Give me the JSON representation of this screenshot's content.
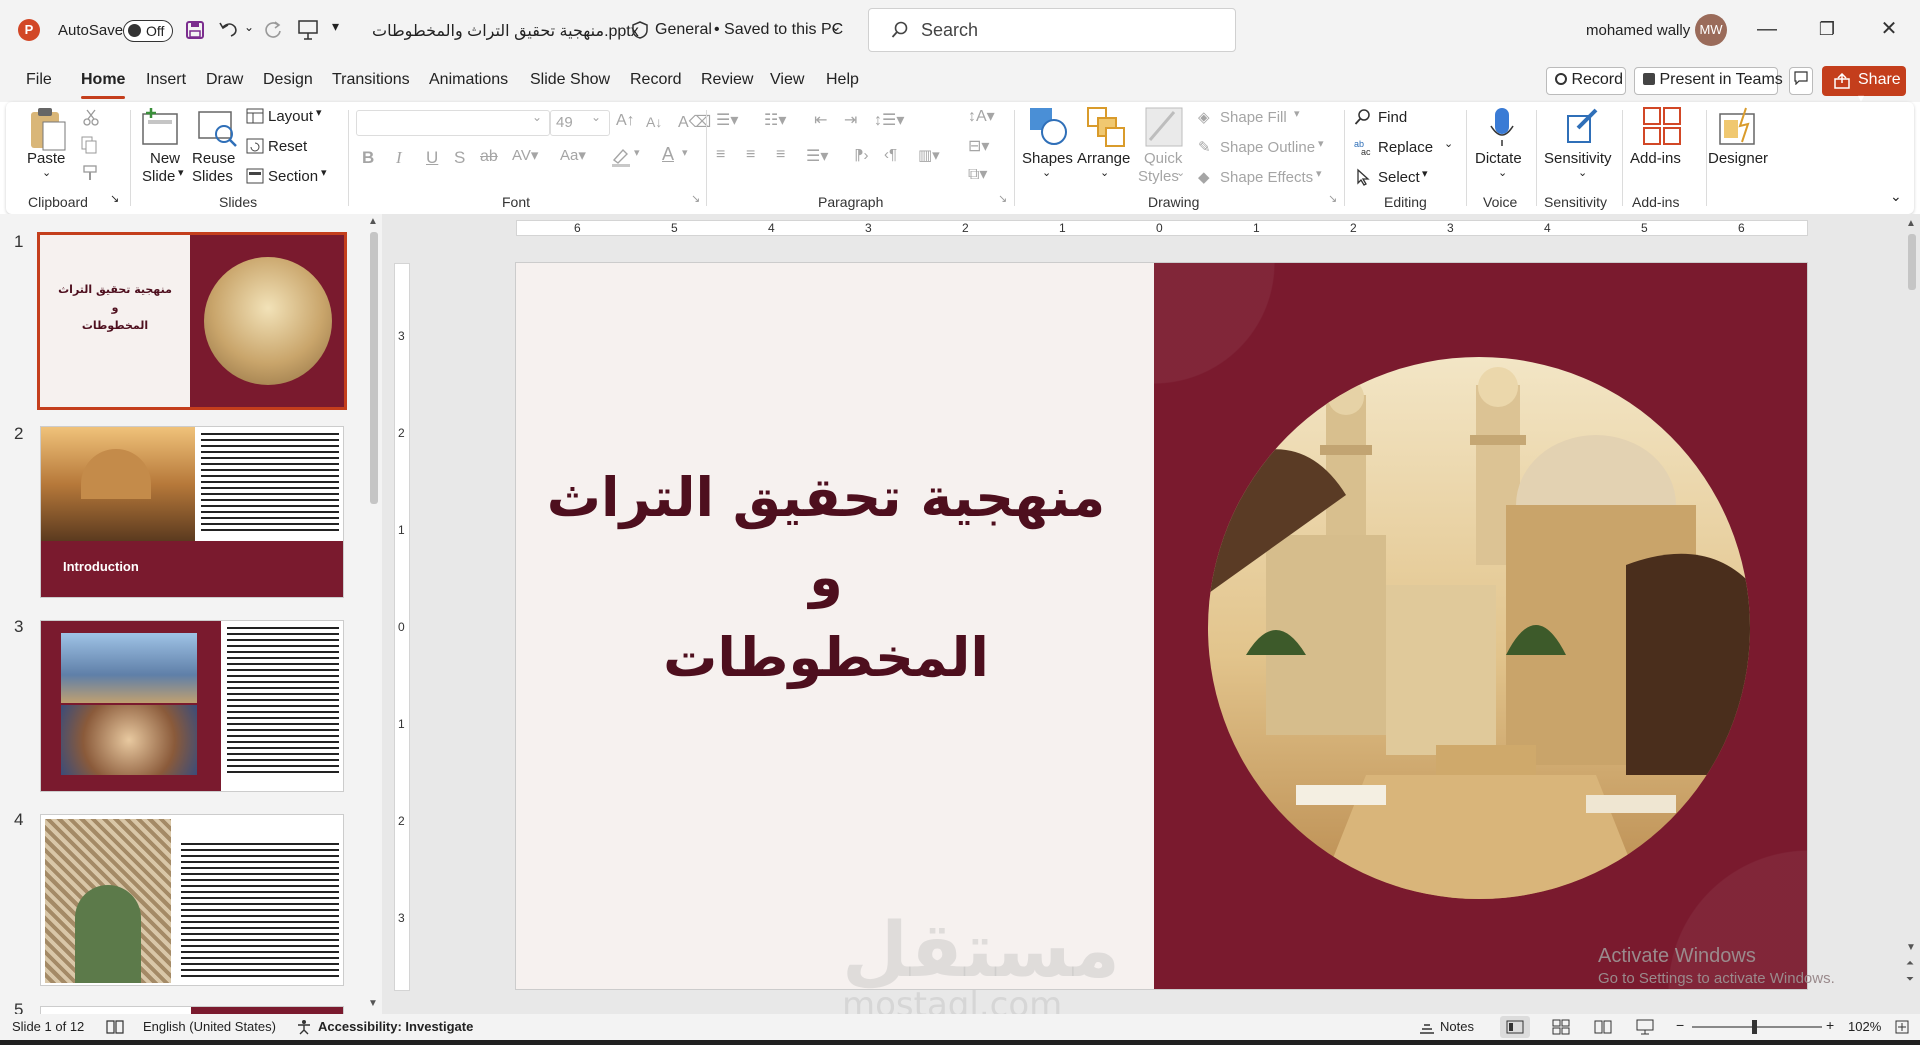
{
  "app": {
    "autosave_label": "AutoSave",
    "autosave_state": "Off",
    "file_title": "منهجية تحقيق التراث والمخطوطات.pptx",
    "sensitivity_label": "General",
    "save_status": "• Saved to this PC",
    "search_placeholder": "Search",
    "user_name": "mohamed wally",
    "user_initials": "MW"
  },
  "menu": {
    "tabs": [
      "File",
      "Home",
      "Insert",
      "Draw",
      "Design",
      "Transitions",
      "Animations",
      "Slide Show",
      "Record",
      "Review",
      "View",
      "Help"
    ],
    "active_tab": "Home",
    "record_button": "Record",
    "present_teams_button": "Present in Teams",
    "share_button": "Share"
  },
  "ribbon": {
    "clipboard": {
      "paste": "Paste",
      "group": "Clipboard"
    },
    "slides": {
      "new_slide_1": "New",
      "new_slide_2": "Slide",
      "reuse_1": "Reuse",
      "reuse_2": "Slides",
      "layout": "Layout",
      "reset": "Reset",
      "section": "Section",
      "group": "Slides"
    },
    "font": {
      "size_value": "49",
      "bold": "B",
      "italic": "I",
      "underline": "U",
      "shadow": "S",
      "strike": "ab",
      "group": "Font"
    },
    "paragraph": {
      "group": "Paragraph"
    },
    "drawing": {
      "shapes": "Shapes",
      "arrange": "Arrange",
      "quick_1": "Quick",
      "quick_2": "Styles",
      "shape_fill": "Shape Fill",
      "shape_outline": "Shape Outline",
      "shape_effects": "Shape Effects",
      "group": "Drawing"
    },
    "editing": {
      "find": "Find",
      "replace": "Replace",
      "select": "Select",
      "group": "Editing"
    },
    "voice": {
      "dictate": "Dictate",
      "group": "Voice"
    },
    "sensitivity": {
      "label": "Sensitivity",
      "group": "Sensitivity"
    },
    "addins": {
      "label": "Add-ins",
      "group": "Add-ins"
    },
    "designer": {
      "label": "Designer"
    }
  },
  "slides_pane": {
    "numbers": [
      "1",
      "2",
      "3",
      "4",
      "5"
    ],
    "slide1_title_lines": [
      "منهجية تحقيق التراث",
      "و",
      "المخطوطات"
    ],
    "slide2_caption": "Introduction"
  },
  "ruler": {
    "h_labels": [
      "6",
      "5",
      "4",
      "3",
      "2",
      "1",
      "0",
      "1",
      "2",
      "3",
      "4",
      "5",
      "6"
    ],
    "v_labels": [
      "3",
      "2",
      "1",
      "0",
      "1",
      "2",
      "3"
    ]
  },
  "slide": {
    "title_lines": [
      "منهجية تحقيق التراث",
      "و",
      "المخطوطات"
    ],
    "bg_color": "#f6f1ef",
    "accent_color": "#7a1a2e",
    "title_color": "#4e0f1e"
  },
  "overlay": {
    "activate_title": "Activate Windows",
    "activate_sub": "Go to Settings to activate Windows.",
    "watermark_ar": "مستقل",
    "watermark_en": "mostaql.com"
  },
  "status": {
    "slide_count": "Slide 1 of 12",
    "language": "English (United States)",
    "accessibility": "Accessibility: Investigate",
    "notes": "Notes",
    "zoom": "102%"
  }
}
